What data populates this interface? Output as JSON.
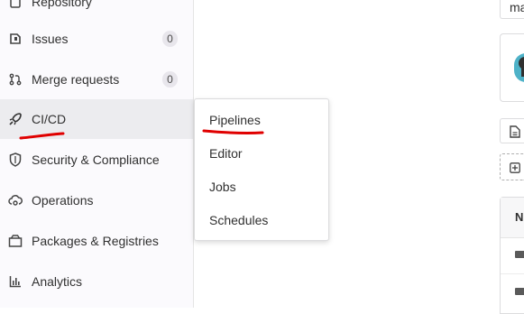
{
  "sidebar": {
    "items": [
      {
        "label": "Repository",
        "icon": "doc-icon"
      },
      {
        "label": "Issues",
        "icon": "issues-icon",
        "badge": "0"
      },
      {
        "label": "Merge requests",
        "icon": "merge-request-icon",
        "badge": "0"
      },
      {
        "label": "CI/CD",
        "icon": "rocket-icon",
        "active": true
      },
      {
        "label": "Security & Compliance",
        "icon": "shield-icon"
      },
      {
        "label": "Operations",
        "icon": "cloud-gear-icon"
      },
      {
        "label": "Packages & Registries",
        "icon": "package-icon"
      },
      {
        "label": "Analytics",
        "icon": "chart-icon"
      }
    ]
  },
  "flyout": {
    "items": [
      {
        "label": "Pipelines"
      },
      {
        "label": "Editor"
      },
      {
        "label": "Jobs"
      },
      {
        "label": "Schedules"
      }
    ]
  },
  "right_panel": {
    "branch_text": "ma",
    "table_header": "N"
  },
  "colors": {
    "annotation": "#e00000",
    "active_bg": "#ececef",
    "sidebar_bg": "#fbfafd"
  }
}
